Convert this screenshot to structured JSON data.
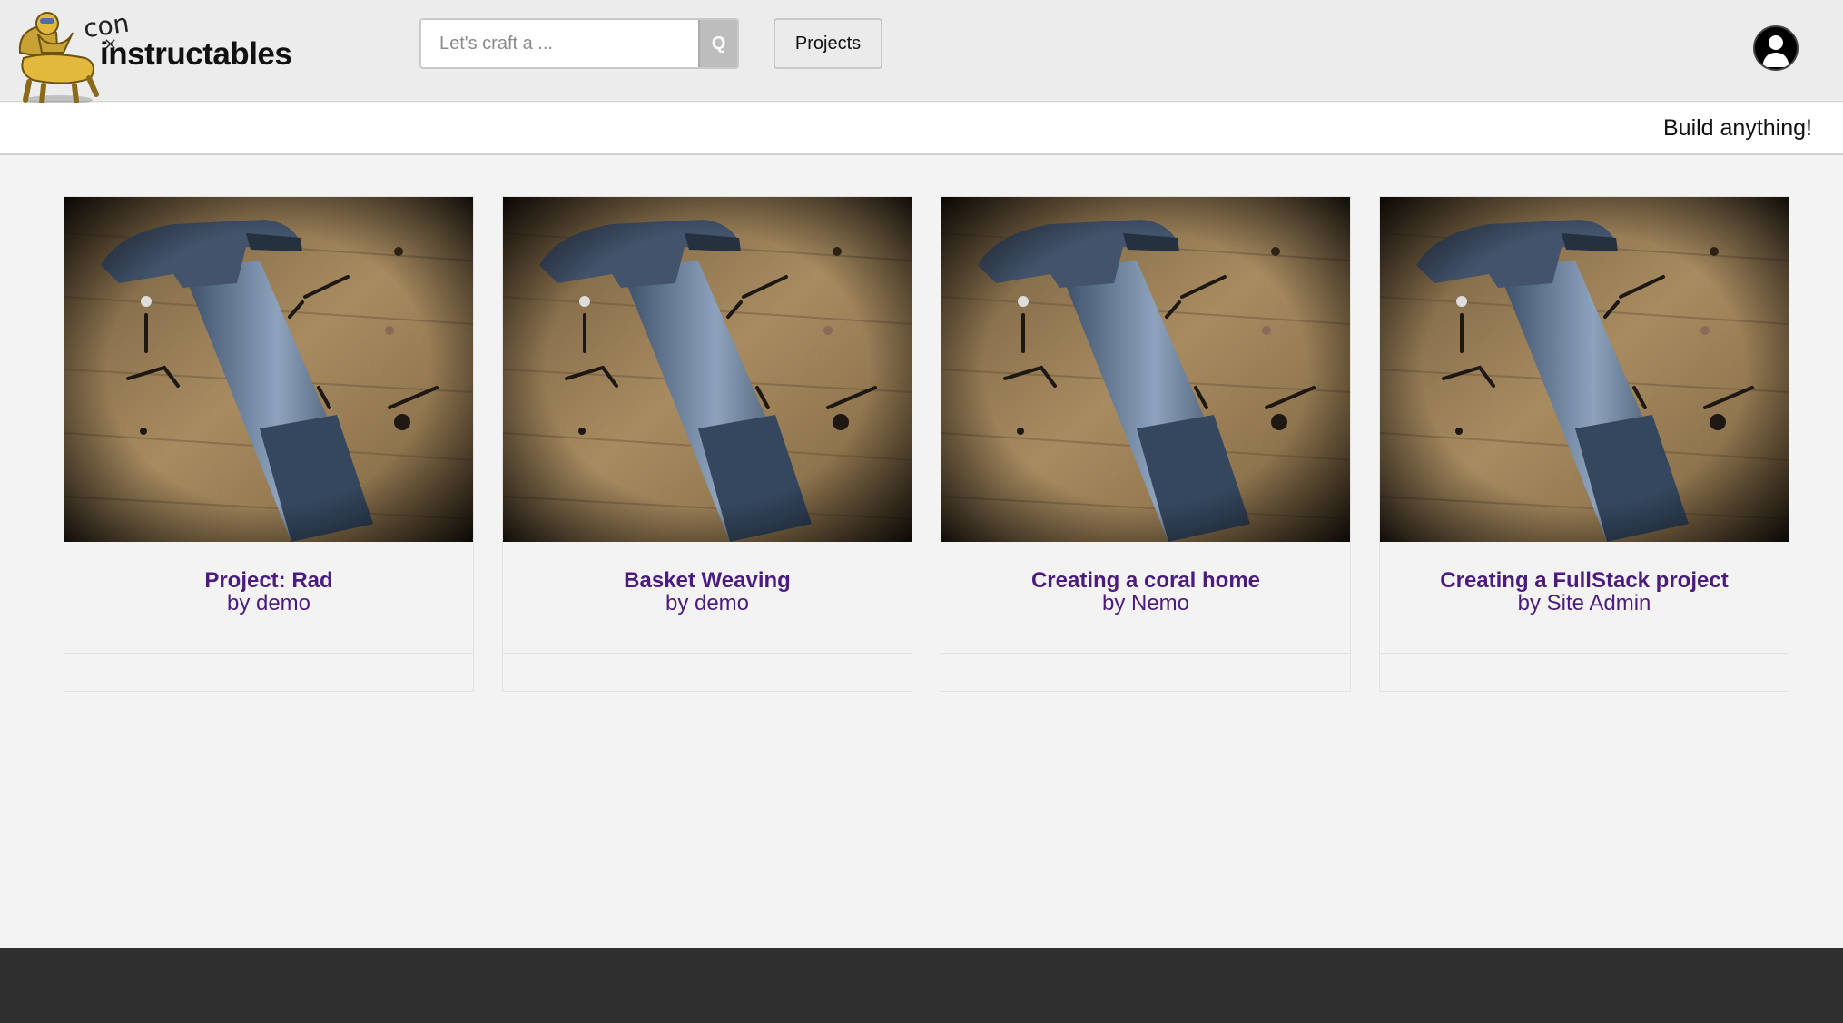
{
  "header": {
    "logo": {
      "prefix_handwritten": "con",
      "wordmark": "instructables",
      "strike_mark": "×"
    },
    "search": {
      "placeholder": "Let's craft a ...",
      "value": "",
      "button_label": "Q"
    },
    "nav": {
      "projects_label": "Projects"
    }
  },
  "banner": {
    "tagline": "Build anything!"
  },
  "projects": [
    {
      "title": "Project: Rad",
      "author": "by demo"
    },
    {
      "title": "Basket Weaving",
      "author": "by demo"
    },
    {
      "title": "Creating a coral home",
      "author": "by Nemo"
    },
    {
      "title": "Creating a FullStack project",
      "author": "by Site Admin"
    }
  ],
  "colors": {
    "link": "#4b1c7e",
    "topbar_bg": "#ececec",
    "page_bg": "#f3f3f3",
    "footer_bg": "#2f2f2f"
  },
  "icons": {
    "avatar": "user-avatar-icon",
    "logo": "chair-mascot-logo",
    "thumbnail": "hammer-and-nails-photo"
  }
}
